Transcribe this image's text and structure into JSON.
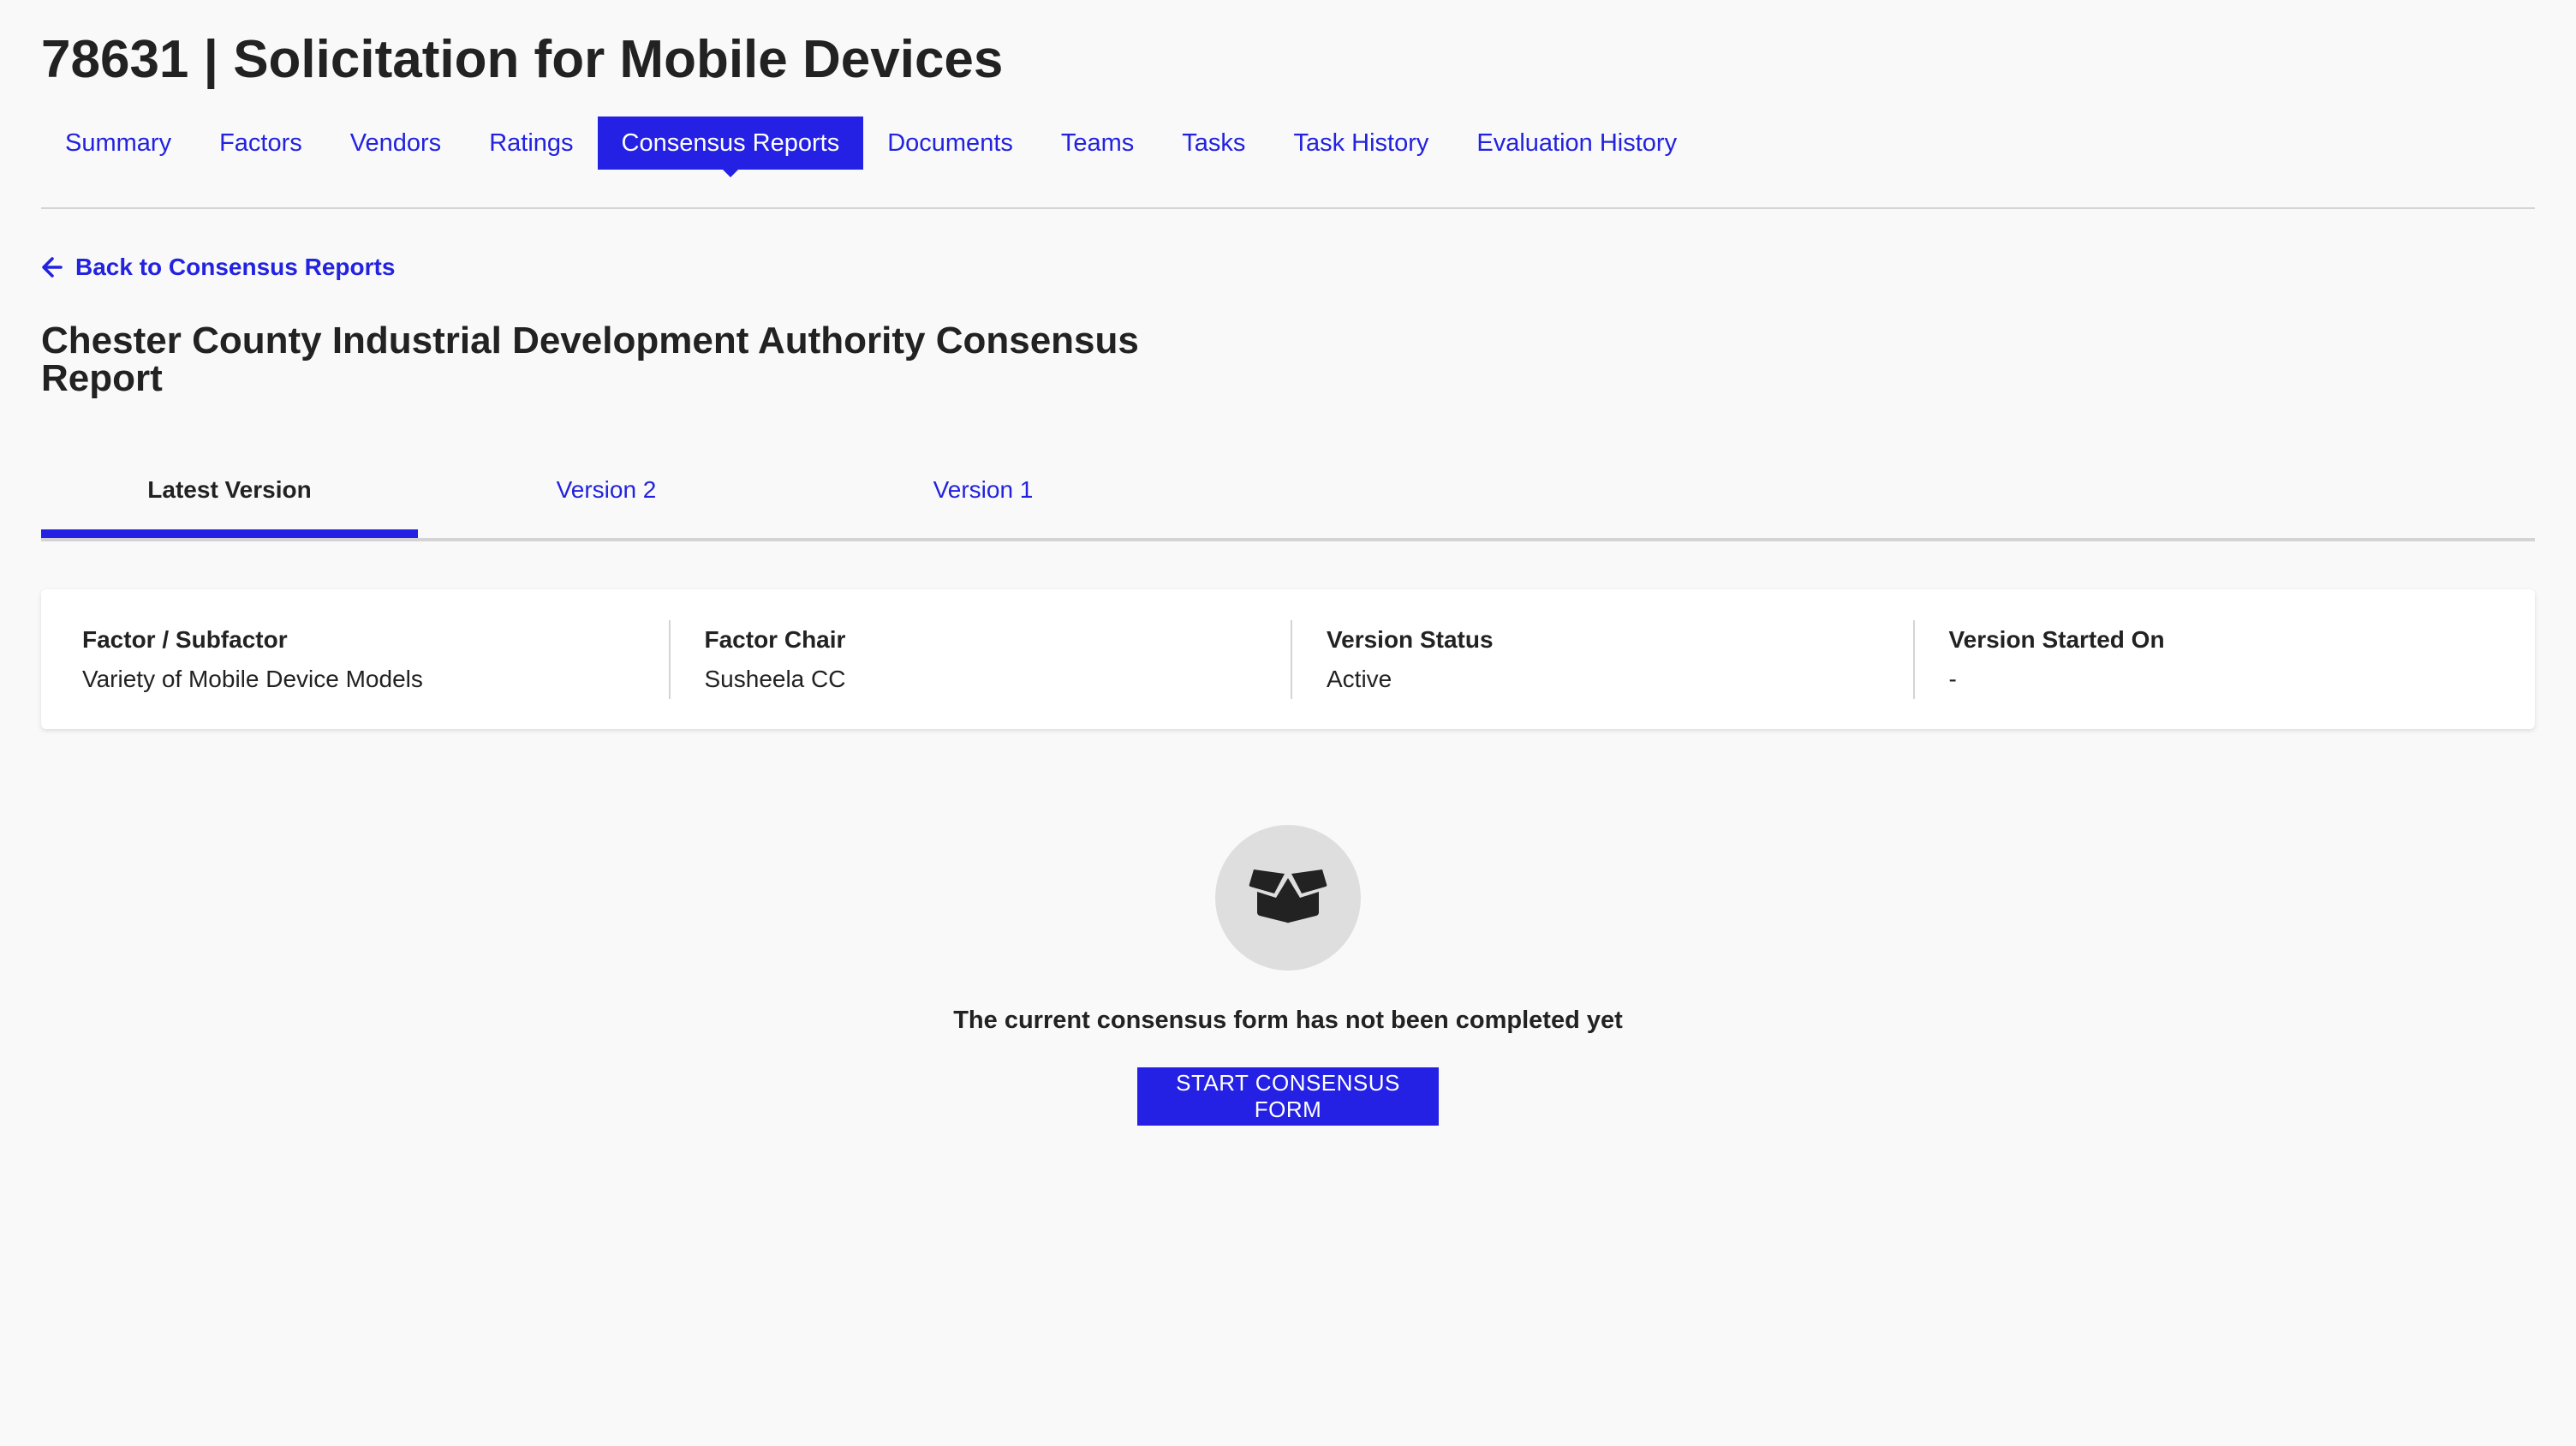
{
  "header": {
    "title": "78631 | Solicitation for Mobile Devices"
  },
  "nav": {
    "items": [
      {
        "label": "Summary",
        "active": false
      },
      {
        "label": "Factors",
        "active": false
      },
      {
        "label": "Vendors",
        "active": false
      },
      {
        "label": "Ratings",
        "active": false
      },
      {
        "label": "Consensus Reports",
        "active": true
      },
      {
        "label": "Documents",
        "active": false
      },
      {
        "label": "Teams",
        "active": false
      },
      {
        "label": "Tasks",
        "active": false
      },
      {
        "label": "Task History",
        "active": false
      },
      {
        "label": "Evaluation History",
        "active": false
      }
    ]
  },
  "back_link": {
    "icon": "arrow-left-icon",
    "label": "Back to Consensus Reports"
  },
  "report": {
    "title": "Chester County Industrial Development Authority Consensus Report"
  },
  "version_tabs": [
    {
      "label": "Latest Version",
      "active": true
    },
    {
      "label": "Version 2",
      "active": false
    },
    {
      "label": "Version 1",
      "active": false
    }
  ],
  "info_card": {
    "columns": [
      {
        "label": "Factor / Subfactor",
        "value": "Variety of Mobile Device Models"
      },
      {
        "label": "Factor Chair",
        "value": "Susheela CC"
      },
      {
        "label": "Version Status",
        "value": "Active"
      },
      {
        "label": "Version Started On",
        "value": "-"
      }
    ]
  },
  "empty_state": {
    "icon": "open-box-icon",
    "message": "The current consensus form has not been completed yet",
    "button_label": "START CONSENSUS FORM"
  },
  "colors": {
    "accent": "#2421e4",
    "link": "#2222e0",
    "text": "#222222",
    "background": "#f9f9f9",
    "divider": "#d4d4d4"
  }
}
